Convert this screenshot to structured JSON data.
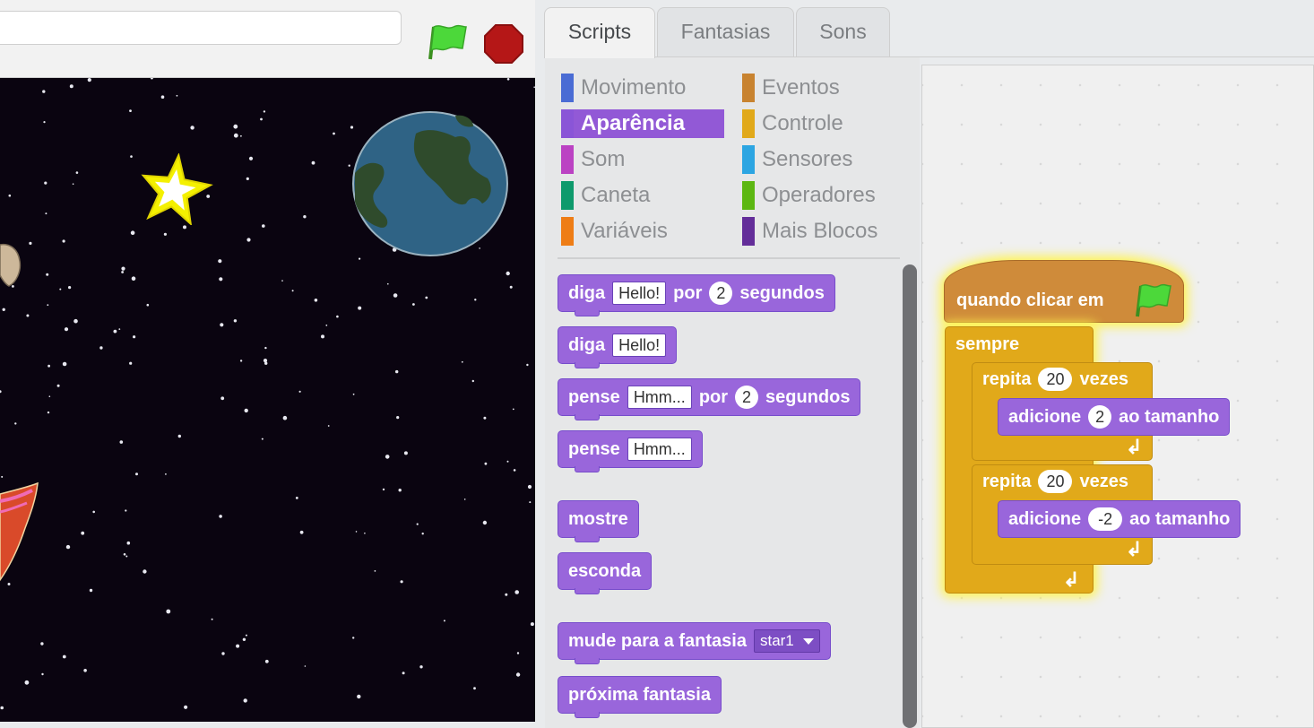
{
  "stage": {
    "title_value": "",
    "icons": {
      "flag": "green-flag-icon",
      "stop": "stop-sign-icon"
    },
    "sprites": [
      "star",
      "planet-earth",
      "rocket",
      "astronaut"
    ]
  },
  "tabs": [
    {
      "label": "Scripts",
      "active": true
    },
    {
      "label": "Fantasias",
      "active": false
    },
    {
      "label": "Sons",
      "active": false
    }
  ],
  "categories": {
    "left": [
      {
        "label": "Movimento",
        "color": "#4a6cd4"
      },
      {
        "label": "Aparência",
        "color": "#8a55d7",
        "selected": true
      },
      {
        "label": "Som",
        "color": "#bb42c3"
      },
      {
        "label": "Caneta",
        "color": "#0e9a6c"
      },
      {
        "label": "Variáveis",
        "color": "#ee7d16"
      }
    ],
    "right": [
      {
        "label": "Eventos",
        "color": "#c88330"
      },
      {
        "label": "Controle",
        "color": "#e1a91a"
      },
      {
        "label": "Sensores",
        "color": "#2ca5e2"
      },
      {
        "label": "Operadores",
        "color": "#5cb712"
      },
      {
        "label": "Mais Blocos",
        "color": "#632d99"
      }
    ]
  },
  "palette": {
    "say_for": {
      "word1": "diga",
      "text": "Hello!",
      "word2": "por",
      "secs": "2",
      "word3": "segundos"
    },
    "say": {
      "word1": "diga",
      "text": "Hello!"
    },
    "think_for": {
      "word1": "pense",
      "text": "Hmm...",
      "word2": "por",
      "secs": "2",
      "word3": "segundos"
    },
    "think": {
      "word1": "pense",
      "text": "Hmm..."
    },
    "show": "mostre",
    "hide": "esconda",
    "switch_costume": {
      "label": "mude para a fantasia",
      "value": "star1"
    },
    "next_costume": "próxima fantasia"
  },
  "script": {
    "hat": "quando clicar em",
    "forever": "sempre",
    "repeat1": {
      "word1": "repita",
      "count": "20",
      "word2": "vezes"
    },
    "change1": {
      "word1": "adicione",
      "value": "2",
      "word2": "ao tamanho"
    },
    "repeat2": {
      "word1": "repita",
      "count": "20",
      "word2": "vezes"
    },
    "change2": {
      "word1": "adicione",
      "value": "-2",
      "word2": "ao tamanho"
    },
    "loop_arrow": "↲"
  },
  "colors": {
    "looks": "#9966db",
    "control": "#e1a91a",
    "events": "#cf8b3a",
    "stage_bg": "#0a0410",
    "glow": "#fff34d"
  }
}
